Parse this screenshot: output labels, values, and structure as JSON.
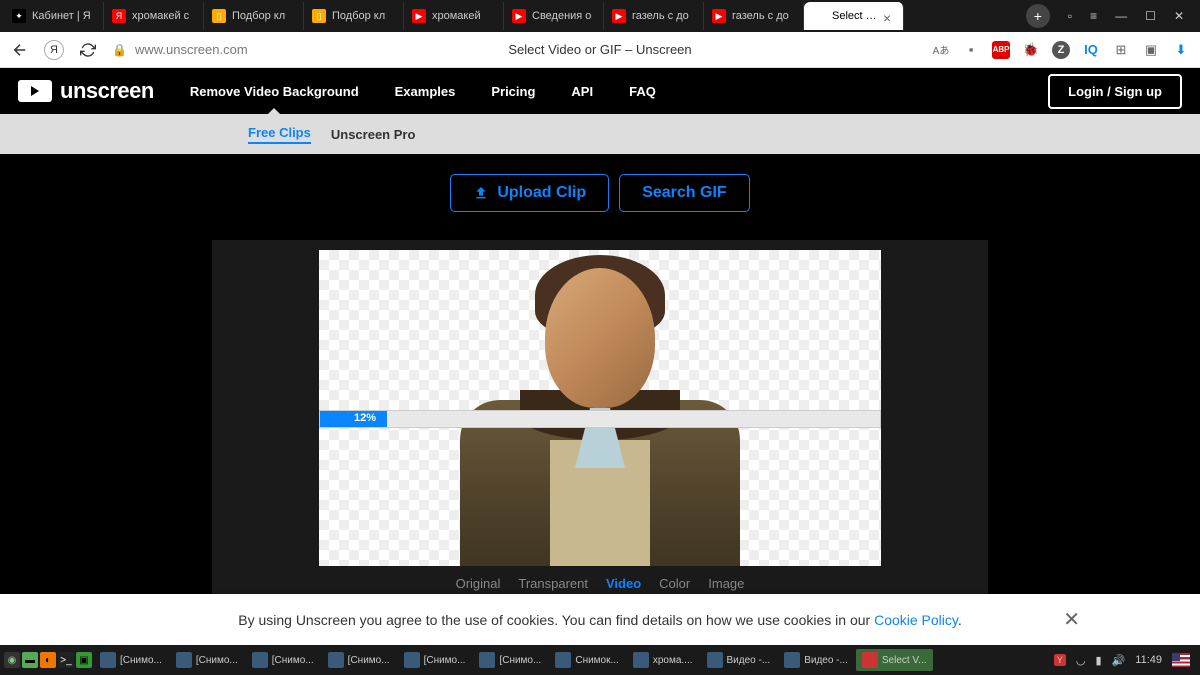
{
  "browser": {
    "tabs": [
      {
        "title": "Кабинет | Я",
        "favicon_bg": "#000",
        "favicon_char": "✦"
      },
      {
        "title": "хромакей с",
        "favicon_bg": "#f00",
        "favicon_char": "Я"
      },
      {
        "title": "Подбор кл",
        "favicon_bg": "#fa0",
        "favicon_char": "▯"
      },
      {
        "title": "Подбор кл",
        "favicon_bg": "#fa0",
        "favicon_char": "▯"
      },
      {
        "title": "хромакей",
        "favicon_bg": "#f00",
        "favicon_char": "▶"
      },
      {
        "title": "Сведения о",
        "favicon_bg": "#f00",
        "favicon_char": "▶"
      },
      {
        "title": "газель с до",
        "favicon_bg": "#f00",
        "favicon_char": "▶"
      },
      {
        "title": "газель с до",
        "favicon_bg": "#f00",
        "favicon_char": "▶"
      },
      {
        "title": "Select Vid",
        "favicon_bg": "#fff",
        "favicon_char": "",
        "active": true
      }
    ],
    "url": "www.unscreen.com",
    "page_title": "Select Video or GIF – Unscreen"
  },
  "nav": {
    "logo": "unscreen",
    "links": [
      "Remove Video Background",
      "Examples",
      "Pricing",
      "API",
      "FAQ"
    ],
    "login": "Login / Sign up"
  },
  "subnav": {
    "free": "Free Clips",
    "pro": "Unscreen Pro"
  },
  "actions": {
    "upload": "Upload Clip",
    "search": "Search GIF"
  },
  "progress": {
    "percent": 12,
    "label": "12%"
  },
  "bg_tabs": [
    "Original",
    "Transparent",
    "Video",
    "Color",
    "Image"
  ],
  "bg_tab_active": 2,
  "cookie": {
    "text_pre": "By using Unscreen you agree to the use of cookies. You can find details on how we use cookies in our ",
    "link": "Cookie Policy",
    "text_post": "."
  },
  "taskbar": {
    "items": [
      {
        "label": "[Снимо..."
      },
      {
        "label": "[Снимо..."
      },
      {
        "label": "[Снимо..."
      },
      {
        "label": "[Снимо..."
      },
      {
        "label": "[Снимо..."
      },
      {
        "label": "[Снимо..."
      },
      {
        "label": "Снимок..."
      },
      {
        "label": "хрома...."
      },
      {
        "label": "Видео -..."
      },
      {
        "label": "Видео -..."
      },
      {
        "label": "Select V...",
        "active": true
      }
    ],
    "clock": "11:49"
  }
}
